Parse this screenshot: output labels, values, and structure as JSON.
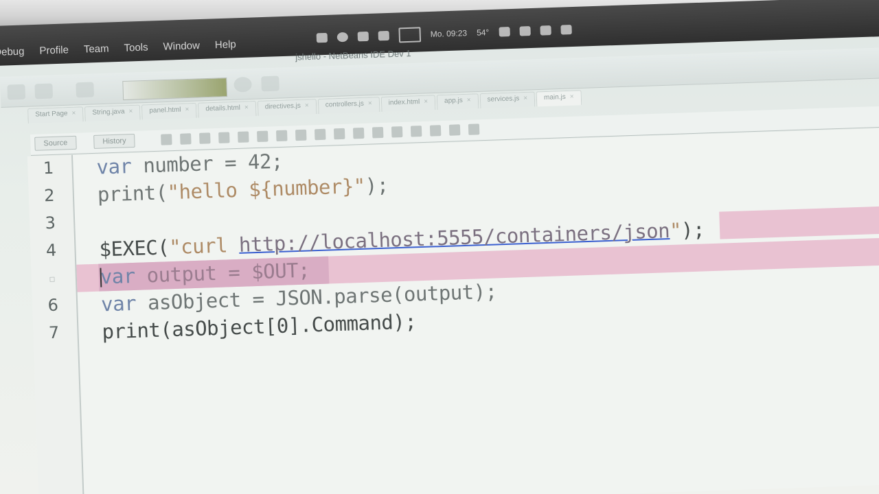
{
  "menubar": {
    "menus": [
      "Debug",
      "Profile",
      "Team",
      "Tools",
      "Window",
      "Help"
    ],
    "clock": "Mo. 09:23",
    "temperature": "54°"
  },
  "window": {
    "title": "jshello - NetBeans IDE Dev 1"
  },
  "file_tabs": [
    {
      "label": "Start Page"
    },
    {
      "label": "String.java"
    },
    {
      "label": "panel.html"
    },
    {
      "label": "details.html"
    },
    {
      "label": "directives.js"
    },
    {
      "label": "controllers.js"
    },
    {
      "label": "index.html"
    },
    {
      "label": "app.js"
    },
    {
      "label": "services.js"
    },
    {
      "label": "main.js"
    }
  ],
  "editor": {
    "source_tab": "Source",
    "history_tab": "History",
    "lines": [
      {
        "number": "1",
        "text": "var number = 42;"
      },
      {
        "number": "2",
        "text": "print(\"hello ${number}\");"
      },
      {
        "number": "3",
        "text": ""
      },
      {
        "number": "4",
        "text": "$EXEC(\"curl http://localhost:5555/containers/json\");"
      },
      {
        "number": "▫",
        "text": "var output = $OUT;"
      },
      {
        "number": "6",
        "text": "var asObject = JSON.parse(output);"
      },
      {
        "number": "7",
        "text": "print(asObject[0].Command);"
      }
    ]
  },
  "colors": {
    "menubar": "#2f2f2f",
    "editor_bg": "#f1f4f1",
    "error_highlight": "#e7b9cd",
    "keyword": "#6f84a8",
    "string": "#ae8b66",
    "link_underline": "#3a5fd0"
  }
}
